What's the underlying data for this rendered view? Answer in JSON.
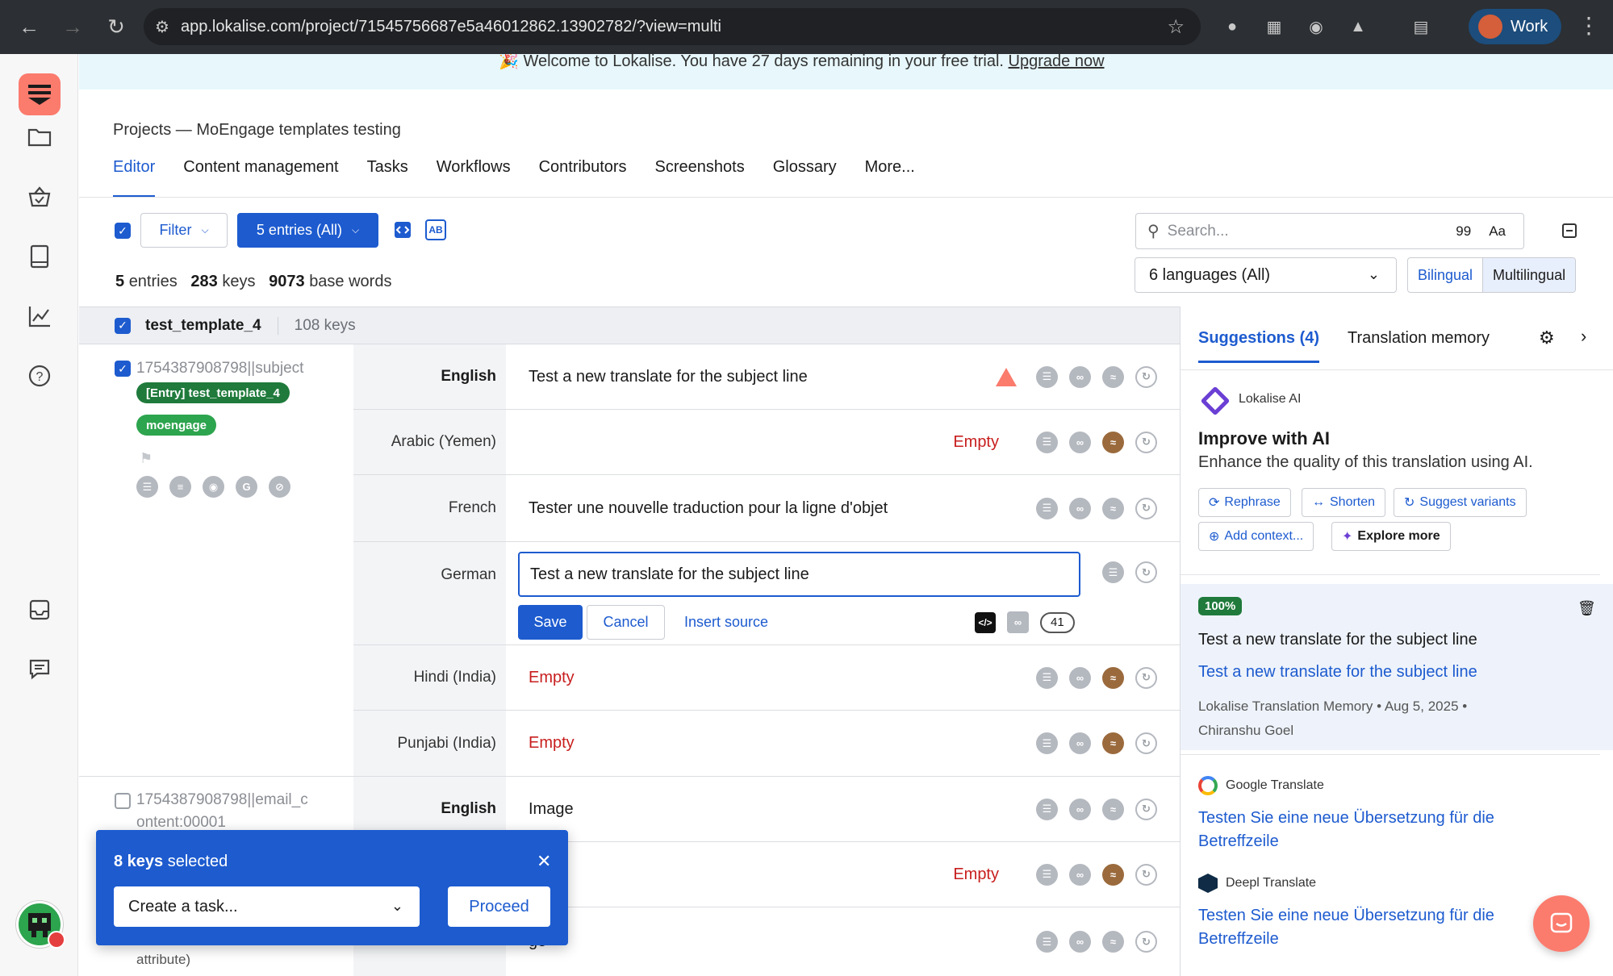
{
  "browser": {
    "url": "app.lokalise.com/project/71545756687e5a46012862.13902782/?view=multi",
    "profile_label": "Work"
  },
  "banner": {
    "text": "🎉 Welcome to Lokalise. You have 27 days remaining in your free trial.",
    "link": "Upgrade now"
  },
  "header": {
    "breadcrumb": "Projects — MoEngage templates testing",
    "tabs": [
      "Editor",
      "Content management",
      "Tasks",
      "Workflows",
      "Contributors",
      "Screenshots",
      "Glossary",
      "More..."
    ],
    "active_tab": "Editor"
  },
  "toolbar": {
    "filter_label": "Filter",
    "entries_label": "5 entries (All)",
    "stats": {
      "entries_count": "5",
      "entries_label": "entries",
      "keys_count": "283",
      "keys_label": "keys",
      "words_count": "9073",
      "words_label": "base words"
    },
    "search_placeholder": "Search...",
    "search_quote": "99",
    "search_case": "Aa",
    "languages_select": "6 languages (All)",
    "view_bilingual": "Bilingual",
    "view_multilingual": "Multilingual"
  },
  "group": {
    "name": "test_template_4",
    "keys": "108 keys"
  },
  "key1": {
    "id": "1754387908798||subject",
    "entry_tag": "[Entry] test_template_4",
    "tag": "moengage"
  },
  "key2": {
    "id_line1": "1754387908798||email_c",
    "id_line2": "ontent:00001",
    "tail": "attribute)"
  },
  "rows": [
    {
      "lang": "English",
      "value": "Test a new translate for the subject line",
      "status": ""
    },
    {
      "lang": "Arabic (Yemen)",
      "value": "",
      "status": "Empty"
    },
    {
      "lang": "French",
      "value": "Tester une nouvelle traduction pour la ligne d'objet",
      "status": ""
    },
    {
      "lang": "German",
      "value": "Test a new translate for the subject line",
      "status": ""
    },
    {
      "lang": "Hindi (India)",
      "value": "",
      "status": "Empty"
    },
    {
      "lang": "Punjabi (India)",
      "value": "",
      "status": "Empty"
    },
    {
      "lang": "English",
      "value": "Image",
      "status": ""
    },
    {
      "lang": "",
      "value": "",
      "status": "Empty"
    },
    {
      "lang": "",
      "value": "ge",
      "status": ""
    }
  ],
  "editor": {
    "save": "Save",
    "cancel": "Cancel",
    "insert_source": "Insert source",
    "count": "41"
  },
  "selection": {
    "count": "8 keys",
    "label": "selected",
    "task_placeholder": "Create a task...",
    "proceed": "Proceed"
  },
  "suggestions": {
    "tab_suggestions": "Suggestions (4)",
    "tab_memory": "Translation memory",
    "ai_name": "Lokalise AI",
    "ai_title": "Improve with AI",
    "ai_desc": "Enhance the quality of this translation using AI.",
    "chips": [
      "Rephrase",
      "Shorten",
      "Suggest variants",
      "Add context...",
      "Explore more"
    ],
    "tm": {
      "match": "100%",
      "source": "Test a new translate for the subject line",
      "target": "Test a new translate for the subject line",
      "meta": "Lokalise Translation Memory • Aug 5, 2025 • Chiranshu Goel"
    },
    "google": {
      "name": "Google Translate",
      "text": "Testen Sie eine neue Übersetzung für die Betreffzeile"
    },
    "deepl": {
      "name": "Deepl Translate",
      "text": "Testen Sie eine neue Übersetzung für die Betreffzeile"
    }
  },
  "colors": {
    "brand_blue": "#1d5bcf",
    "empty_red": "#c81e1e",
    "lokalise_coral": "#fb7b6d",
    "tag_green": "#2da44e"
  }
}
